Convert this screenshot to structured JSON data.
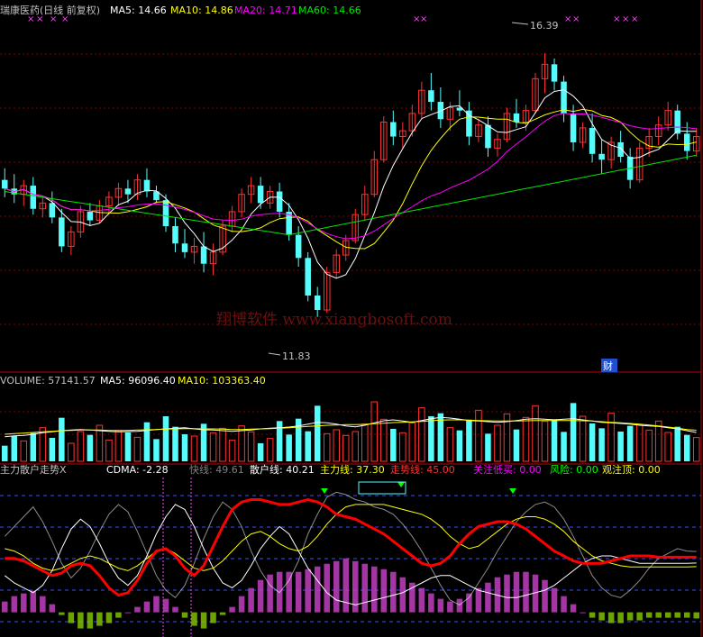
{
  "colors": {
    "up": "#ff3232",
    "down": "#54fcfc",
    "ma5": "#ffffff",
    "ma10": "#ffff00",
    "ma20": "#ff00ff",
    "ma60": "#00e600",
    "grid": "#800000",
    "frame": "#c00000",
    "dash": "#3c4dff",
    "text": "#c0c0c0",
    "cdma": "#ffffff",
    "fast": "#ffffff",
    "retail": "#ffffff",
    "main": "#ffff00",
    "trend": "#ff0000",
    "attention": "#ff00ff",
    "risk": "#00ff00",
    "top": "#ffff00",
    "hist_pos": "#c040c0",
    "hist_neg": "#80c000",
    "marker": "#ff44ff"
  },
  "price_panel": {
    "title": "瑞康医药(日线 前复权)",
    "ma5_label": "MA5: 14.66",
    "ma10_label": "MA10: 14.86",
    "ma20_label": "MA20: 14.71",
    "ma60_label": "MA60: 14.66",
    "high_label": "16.39",
    "low_label": "11.83",
    "fin_marker": "财",
    "watermark": "翔博软件 www.xiangbosoft.com"
  },
  "volume_panel": {
    "volume_label": "VOLUME: 57141.57",
    "ma5_label": "MA5: 96096.40",
    "ma10_label": "MA10: 103363.40"
  },
  "indicator_panel": {
    "name": "主力散户走势X",
    "cdma": "CDMA: -2.28",
    "fast": "快线: 49.61",
    "retail": "散户线: 40.21",
    "main": "主力线: 37.30",
    "trend": "走势线: 45.00",
    "attention": "关注低买: 0.00",
    "risk": "风险: 0.00",
    "top": "观注顶: 0.00"
  },
  "chart_data": [
    {
      "type": "candlestick",
      "title": "瑞康医药(日线 前复权)",
      "ylim": [
        11.0,
        17.0
      ],
      "highest_marked": 16.39,
      "lowest_marked": 11.83,
      "candles": [
        [
          14.2,
          14.4,
          13.9,
          14.05
        ],
        [
          14.05,
          14.3,
          13.8,
          13.95
        ],
        [
          13.95,
          14.2,
          13.75,
          14.1
        ],
        [
          14.1,
          14.25,
          13.6,
          13.7
        ],
        [
          13.7,
          13.9,
          13.55,
          13.8
        ],
        [
          13.8,
          14.0,
          13.45,
          13.55
        ],
        [
          13.55,
          13.7,
          12.95,
          13.05
        ],
        [
          13.05,
          13.4,
          12.9,
          13.3
        ],
        [
          13.3,
          13.75,
          13.2,
          13.65
        ],
        [
          13.65,
          13.8,
          13.4,
          13.5
        ],
        [
          13.5,
          13.85,
          13.45,
          13.75
        ],
        [
          13.75,
          14.0,
          13.6,
          13.9
        ],
        [
          13.9,
          14.15,
          13.75,
          14.05
        ],
        [
          14.05,
          14.2,
          13.8,
          13.95
        ],
        [
          13.95,
          14.3,
          13.85,
          14.2
        ],
        [
          14.2,
          14.4,
          13.9,
          14.0
        ],
        [
          14.0,
          14.1,
          13.8,
          13.85
        ],
        [
          13.85,
          13.95,
          13.3,
          13.4
        ],
        [
          13.4,
          13.55,
          12.95,
          13.1
        ],
        [
          13.1,
          13.35,
          12.85,
          12.95
        ],
        [
          12.95,
          13.2,
          12.75,
          13.05
        ],
        [
          13.05,
          13.3,
          12.6,
          12.75
        ],
        [
          12.75,
          13.1,
          12.55,
          12.95
        ],
        [
          12.95,
          13.5,
          12.9,
          13.4
        ],
        [
          13.4,
          13.75,
          13.3,
          13.65
        ],
        [
          13.65,
          14.05,
          13.55,
          13.95
        ],
        [
          13.95,
          14.25,
          13.8,
          14.1
        ],
        [
          14.1,
          14.25,
          13.7,
          13.8
        ],
        [
          13.8,
          14.1,
          13.7,
          14.0
        ],
        [
          14.0,
          14.15,
          13.55,
          13.65
        ],
        [
          13.65,
          13.8,
          13.15,
          13.25
        ],
        [
          13.25,
          13.4,
          12.7,
          12.85
        ],
        [
          12.85,
          12.95,
          12.1,
          12.2
        ],
        [
          12.2,
          12.35,
          11.83,
          11.95
        ],
        [
          11.95,
          12.7,
          11.9,
          12.6
        ],
        [
          12.6,
          13.0,
          12.5,
          12.9
        ],
        [
          12.9,
          13.25,
          12.8,
          13.15
        ],
        [
          13.15,
          13.7,
          13.1,
          13.6
        ],
        [
          13.6,
          14.1,
          13.5,
          13.95
        ],
        [
          13.95,
          14.7,
          13.9,
          14.55
        ],
        [
          14.55,
          15.3,
          14.5,
          15.2
        ],
        [
          15.2,
          15.4,
          14.8,
          14.95
        ],
        [
          14.95,
          15.2,
          14.75,
          15.05
        ],
        [
          15.05,
          15.5,
          14.95,
          15.35
        ],
        [
          15.35,
          15.9,
          15.25,
          15.75
        ],
        [
          15.75,
          16.05,
          15.4,
          15.55
        ],
        [
          15.55,
          15.8,
          15.1,
          15.25
        ],
        [
          15.25,
          15.55,
          15.05,
          15.45
        ],
        [
          15.45,
          15.75,
          15.3,
          15.4
        ],
        [
          15.4,
          15.55,
          14.8,
          14.95
        ],
        [
          14.95,
          15.25,
          14.85,
          15.15
        ],
        [
          15.15,
          15.3,
          14.6,
          14.75
        ],
        [
          14.75,
          15.0,
          14.6,
          14.9
        ],
        [
          14.9,
          15.45,
          14.85,
          15.35
        ],
        [
          15.35,
          15.6,
          15.1,
          15.2
        ],
        [
          15.2,
          15.5,
          15.05,
          15.4
        ],
        [
          15.4,
          16.05,
          15.35,
          15.95
        ],
        [
          15.95,
          16.39,
          15.7,
          16.2
        ],
        [
          16.2,
          16.3,
          15.75,
          15.9
        ],
        [
          15.9,
          16.0,
          15.2,
          15.35
        ],
        [
          15.35,
          15.5,
          14.7,
          14.85
        ],
        [
          14.85,
          15.2,
          14.75,
          15.1
        ],
        [
          15.1,
          15.35,
          14.5,
          14.65
        ],
        [
          14.65,
          14.9,
          14.3,
          14.55
        ],
        [
          14.55,
          14.95,
          14.4,
          14.85
        ],
        [
          14.85,
          15.05,
          14.5,
          14.6
        ],
        [
          14.6,
          14.75,
          14.05,
          14.2
        ],
        [
          14.2,
          14.85,
          14.15,
          14.75
        ],
        [
          14.75,
          15.1,
          14.6,
          14.95
        ],
        [
          14.95,
          15.3,
          14.8,
          15.15
        ],
        [
          15.15,
          15.55,
          15.05,
          15.4
        ],
        [
          15.4,
          15.5,
          14.9,
          15.0
        ],
        [
          15.0,
          15.2,
          14.55,
          14.7
        ],
        [
          14.7,
          15.1,
          14.6,
          14.95
        ]
      ]
    },
    {
      "type": "bar",
      "title": "VOLUME",
      "ylim": [
        0,
        240000
      ],
      "values": [
        52000,
        85000,
        68000,
        94000,
        112000,
        78000,
        145000,
        60000,
        99000,
        88000,
        120000,
        71000,
        102000,
        96000,
        80000,
        130000,
        74000,
        150000,
        115000,
        90000,
        84000,
        125000,
        95000,
        110000,
        70000,
        118000,
        98000,
        60000,
        76000,
        134000,
        89000,
        142000,
        100000,
        185000,
        92000,
        105000,
        86000,
        99000,
        124000,
        198000,
        140000,
        108000,
        95000,
        128000,
        178000,
        150000,
        160000,
        112000,
        103000,
        138000,
        170000,
        92000,
        120000,
        158000,
        106000,
        146000,
        185000,
        133000,
        140000,
        98000,
        194000,
        150000,
        126000,
        110000,
        160000,
        99000,
        118000,
        122000,
        104000,
        134000,
        96000,
        115000,
        88000,
        79000
      ],
      "ma5": [
        82000,
        85000,
        86000,
        90000,
        95000,
        98000,
        102000,
        104000,
        106000,
        104000,
        102000,
        100000,
        98000,
        99000,
        100000,
        103000,
        106000,
        108000,
        110000,
        112000,
        108000,
        105000,
        104000,
        102000,
        100000,
        102000,
        104000,
        108000,
        110000,
        112000,
        114000,
        118000,
        124000,
        130000,
        128000,
        124000,
        118000,
        115000,
        120000,
        128000,
        135000,
        138000,
        134000,
        130000,
        136000,
        142000,
        146000,
        144000,
        140000,
        136000,
        134000,
        132000,
        130000,
        132000,
        136000,
        140000,
        142000,
        140000,
        138000,
        140000,
        142000,
        138000,
        134000,
        130000,
        128000,
        126000,
        124000,
        120000,
        118000,
        116000,
        112000,
        108000,
        102000,
        96096
      ],
      "ma10": [
        90000,
        92000,
        94000,
        96000,
        98000,
        100000,
        102000,
        103000,
        104000,
        104000,
        104000,
        103000,
        103000,
        103000,
        104000,
        105000,
        106000,
        107000,
        108000,
        109000,
        109000,
        108000,
        108000,
        107000,
        106000,
        106000,
        107000,
        108000,
        109000,
        110000,
        112000,
        114000,
        116000,
        118000,
        120000,
        121000,
        122000,
        122000,
        123000,
        125000,
        127000,
        129000,
        130000,
        131000,
        133000,
        135000,
        137000,
        138000,
        138000,
        137000,
        136000,
        135000,
        134000,
        134000,
        134000,
        135000,
        136000,
        136000,
        136000,
        136000,
        136000,
        135000,
        134000,
        132000,
        130000,
        128000,
        126000,
        124000,
        121000,
        118000,
        114000,
        110000,
        106000,
        103363
      ]
    },
    {
      "type": "line",
      "title": "主力散户走势X",
      "ylim": [
        -15,
        110
      ],
      "series": [
        {
          "name": "快线",
          "values": [
            62,
            70,
            78,
            86,
            74,
            58,
            40,
            28,
            36,
            50,
            66,
            80,
            88,
            82,
            66,
            48,
            30,
            18,
            12,
            22,
            40,
            60,
            78,
            90,
            84,
            70,
            50,
            34,
            22,
            16,
            26,
            42,
            64,
            80,
            94,
            98,
            96,
            92,
            90,
            86,
            84,
            80,
            72,
            62,
            50,
            36,
            22,
            10,
            6,
            12,
            24,
            36,
            50,
            62,
            74,
            82,
            88,
            90,
            86,
            76,
            62,
            46,
            30,
            20,
            14,
            12,
            18,
            26,
            36,
            44,
            48,
            52,
            50,
            49.61
          ]
        },
        {
          "name": "散户线",
          "values": [
            30,
            24,
            20,
            16,
            22,
            34,
            52,
            68,
            76,
            70,
            56,
            40,
            28,
            22,
            30,
            46,
            64,
            78,
            88,
            84,
            70,
            52,
            36,
            24,
            20,
            26,
            38,
            52,
            62,
            70,
            64,
            50,
            36,
            26,
            16,
            10,
            8,
            6,
            8,
            10,
            12,
            14,
            16,
            20,
            24,
            28,
            30,
            30,
            26,
            22,
            18,
            16,
            14,
            12,
            12,
            14,
            16,
            18,
            22,
            28,
            34,
            40,
            44,
            46,
            46,
            44,
            42,
            40,
            40,
            40,
            40,
            40,
            40,
            40.21
          ]
        },
        {
          "name": "主力线",
          "values": [
            52,
            50,
            46,
            40,
            36,
            34,
            36,
            40,
            44,
            46,
            44,
            40,
            36,
            34,
            38,
            44,
            50,
            52,
            48,
            42,
            36,
            34,
            36,
            42,
            50,
            58,
            64,
            66,
            62,
            56,
            52,
            50,
            54,
            62,
            72,
            80,
            86,
            88,
            88,
            88,
            88,
            86,
            84,
            82,
            80,
            76,
            70,
            62,
            56,
            52,
            54,
            60,
            66,
            72,
            76,
            78,
            78,
            76,
            72,
            66,
            58,
            52,
            46,
            42,
            40,
            38,
            37,
            37,
            37,
            37,
            37,
            37,
            37,
            37.3
          ]
        },
        {
          "name": "走势线",
          "values": [
            44,
            44,
            42,
            38,
            34,
            30,
            32,
            38,
            40,
            38,
            30,
            20,
            14,
            16,
            26,
            40,
            50,
            52,
            46,
            36,
            30,
            38,
            54,
            70,
            84,
            90,
            92,
            92,
            90,
            88,
            88,
            90,
            92,
            90,
            86,
            80,
            78,
            76,
            72,
            68,
            64,
            58,
            52,
            46,
            40,
            38,
            40,
            46,
            56,
            64,
            70,
            72,
            74,
            74,
            72,
            68,
            62,
            56,
            50,
            46,
            42,
            40,
            40,
            40,
            42,
            44,
            46,
            46,
            46,
            45,
            45,
            45,
            45,
            45.0
          ]
        },
        {
          "name": "CDMA",
          "values": [
            4,
            6,
            7,
            8,
            6,
            3,
            -1,
            -4,
            -6,
            -6,
            -5,
            -4,
            -2,
            0,
            2,
            4,
            6,
            5,
            2,
            -2,
            -5,
            -6,
            -4,
            -1,
            2,
            6,
            9,
            12,
            14,
            15,
            15,
            15,
            16,
            17,
            18,
            19,
            20,
            19,
            18,
            17,
            16,
            15,
            13,
            11,
            9,
            7,
            5,
            4,
            5,
            7,
            9,
            11,
            13,
            14,
            15,
            15,
            14,
            12,
            9,
            6,
            3,
            0,
            -2,
            -3,
            -4,
            -4,
            -3,
            -3,
            -2,
            -2,
            -2,
            -2,
            -2,
            -2.28
          ]
        }
      ]
    }
  ]
}
